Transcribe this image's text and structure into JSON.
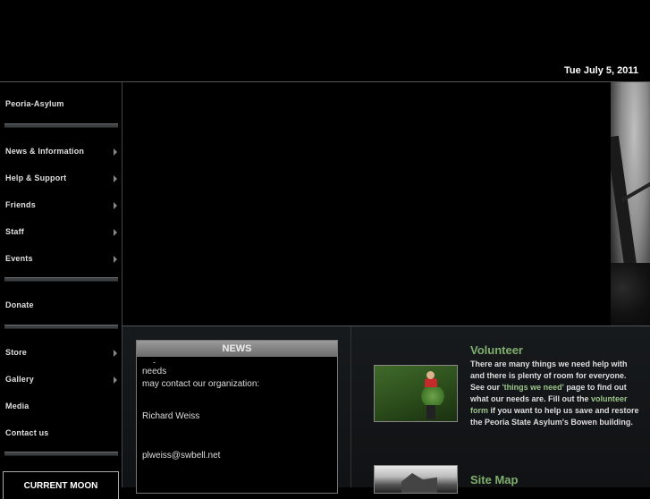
{
  "header": {
    "date": "Tue July 5, 2011"
  },
  "sidebar": {
    "items": [
      {
        "label": "Peoria-Asylum",
        "arrow": false
      },
      {
        "label": "News & Information",
        "arrow": true
      },
      {
        "label": "Help & Support",
        "arrow": true
      },
      {
        "label": "Friends",
        "arrow": true
      },
      {
        "label": "Staff",
        "arrow": true
      },
      {
        "label": "Events",
        "arrow": true
      },
      {
        "label": "Donate",
        "arrow": false
      },
      {
        "label": "Store",
        "arrow": true
      },
      {
        "label": "Gallery",
        "arrow": true
      },
      {
        "label": "Media",
        "arrow": false
      },
      {
        "label": "Contact us",
        "arrow": false
      }
    ],
    "moon_label": "CURRENT MOON"
  },
  "news": {
    "title": "NEWS",
    "cut_line": "Anyone with ideas and or interested as our needs",
    "line1": "may contact our organization:",
    "name": "Richard Weiss",
    "email": "plweiss@swbell.net"
  },
  "volunteer": {
    "title": "Volunteer",
    "text_a": "There are many things we need help with and there is plenty of room for everyone. See our ",
    "link1": "'things we need'",
    "text_b": " page to find out what our needs are. Fill out the ",
    "link2": "volunteer form",
    "text_c": " if you want to help us save and restore the Peoria State Asylum's Bowen building."
  },
  "sitemap": {
    "title": "Site Map"
  },
  "colors": {
    "accent": "#7fae6e",
    "link": "#9bc48a",
    "background": "#000000"
  }
}
